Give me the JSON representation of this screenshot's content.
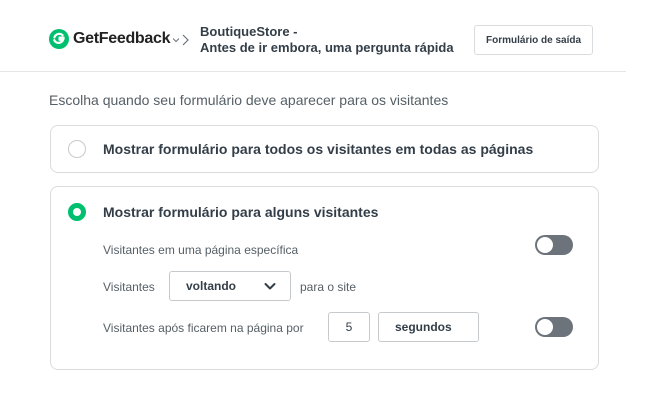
{
  "header": {
    "brand": "GetFeedback",
    "survey_name_line1": "BoutiqueStore -",
    "survey_name_line2": "Antes de ir embora, uma pergunta rápida",
    "type_badge": "Formulário de saída"
  },
  "targeting": {
    "section_title": "Escolha quando seu formulário deve aparecer para os visitantes",
    "option_all": {
      "label": "Mostrar formulário para todos os visitantes em todas as páginas",
      "selected": false
    },
    "option_some": {
      "label": "Mostrar formulário para alguns visitantes",
      "selected": true,
      "rule_specific_page": {
        "label": "Visitantes em uma página específica",
        "enabled": false
      },
      "rule_returning": {
        "prefix": "Visitantes",
        "selected_value": "voltando",
        "suffix": "para o site"
      },
      "rule_time_on_page": {
        "label": "Visitantes após ficarem na página por",
        "value": "5",
        "unit": "segundos",
        "enabled": false
      }
    }
  },
  "colors": {
    "accent": "#00bf6f",
    "toggle_off": "#6c737a",
    "border": "#d9dcde",
    "text": "#333e48"
  },
  "icons": {
    "logo": "getfeedback-logo-icon",
    "breadcrumb": "chevron-right-icon",
    "dropdown": "chevron-down-icon"
  }
}
